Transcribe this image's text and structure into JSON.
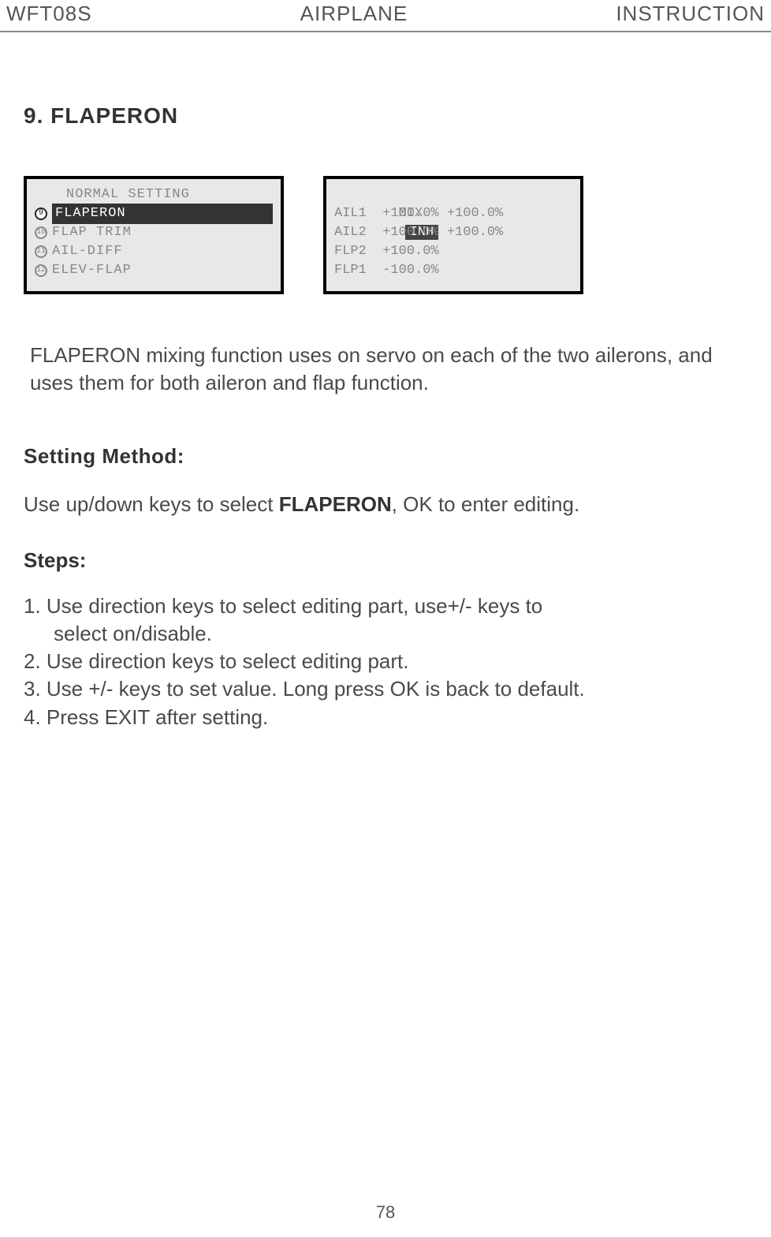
{
  "header": {
    "left": "WFT08S",
    "center": "AIRPLANE",
    "right": "INSTRUCTION"
  },
  "section_title": "9. FLAPERON",
  "lcd1": {
    "title": "NORMAL SETTING",
    "items": [
      {
        "num": "9",
        "label": "FLAPERON",
        "selected": true
      },
      {
        "num": "10",
        "label": "FLAP TRIM",
        "selected": false
      },
      {
        "num": "11",
        "label": "AIL-DIFF",
        "selected": false
      },
      {
        "num": "12",
        "label": "ELEV-FLAP",
        "selected": false
      }
    ]
  },
  "lcd2": {
    "mix_label": "MIX",
    "mix_value": "INH",
    "rows": [
      {
        "label": "AIL1",
        "v1": "+100.0%",
        "v2": "+100.0%"
      },
      {
        "label": "AIL2",
        "v1": "+100.0%",
        "v2": "+100.0%"
      },
      {
        "label": "FLP2",
        "v1": "+100.0%",
        "v2": ""
      },
      {
        "label": "FLP1",
        "v1": "-100.0%",
        "v2": ""
      }
    ]
  },
  "description": " FLAPERON mixing function uses on servo on each of the two ailerons, and uses them for both aileron and flap function.",
  "setting_method_heading": "Setting Method:",
  "setting_method_pre": "Use up/down keys to select ",
  "setting_method_bold": "FLAPERON",
  "setting_method_post": ", OK to enter editing.",
  "steps_heading": "Steps:",
  "steps": {
    "s1a": "1. Use direction keys to select editing part,  use+/- keys  to",
    "s1b": "select on/disable.",
    "s2": "2. Use  direction  keys  to  select  editing  part.",
    "s3": "3. Use +/- keys to set value. Long  press OK is  back to default.",
    "s4": "4. Press EXIT after setting."
  },
  "page_number": "78"
}
